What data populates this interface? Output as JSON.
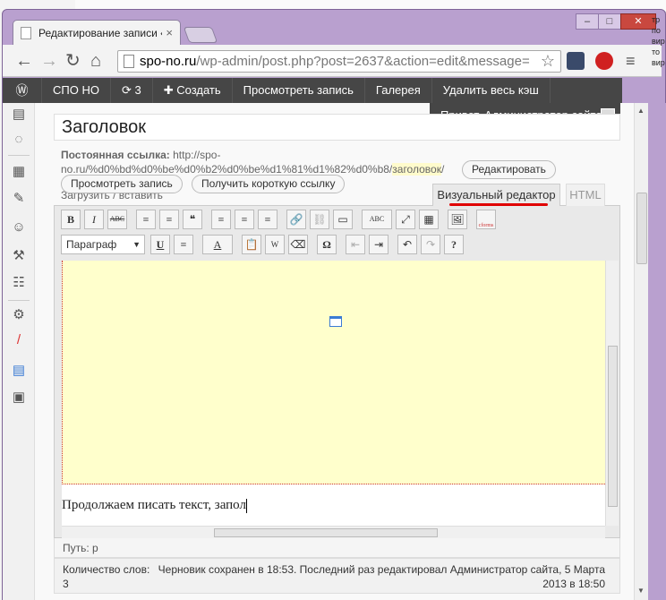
{
  "browser": {
    "tab_title": "Редактирование записи «",
    "tab_close": "×",
    "url_host": "spo-no.ru",
    "url_path": "/wp-admin/post.php?post=2637&action=edit&message=",
    "win_min": "–",
    "win_max": "□",
    "win_close": "✕"
  },
  "desktop_right_text": "тр\nпо\nвир\nто\nвир",
  "adminbar": {
    "site": "СПО НО",
    "updates": "3",
    "add": "Создать",
    "view": "Просмотреть запись",
    "gallery": "Галерея",
    "cache": "Удалить весь кэш",
    "greeting": "Привет, Администратор сайта"
  },
  "post": {
    "title": "Заголовок",
    "permalink_label": "Постоянная ссылка:",
    "permalink_url_1": "http://spo-",
    "permalink_url_2": "no.ru/%d0%bd%d0%be%d0%b2%d0%be%d1%81%d1%82%d0%b8/",
    "permalink_slug": "заголовок",
    "permalink_end": "/",
    "edit_btn": "Редактировать",
    "view_btn": "Просмотреть запись",
    "shortlink_btn": "Получить короткую ссылку",
    "upload_label": "Загрузить / вставить"
  },
  "editor": {
    "tab_visual": "Визуальный редактор",
    "tab_html": "HTML",
    "format": "Параграф",
    "row1": [
      "B",
      "I",
      "ABC",
      "≡",
      "≡",
      "❝",
      "≡",
      "≡",
      "≡",
      "🔗",
      "⛓",
      "▭",
      "ABC",
      "⤢",
      "▦",
      "🖼",
      "cforms"
    ],
    "row2": [
      "U",
      "≡",
      "A",
      "📋",
      "W",
      "⌫",
      "Ω",
      "⇤",
      "⇥",
      "↶",
      "↷",
      "?"
    ],
    "content_text": "Продолжаем писать текст, запол",
    "path": "Путь: p"
  },
  "footer": {
    "word_count": "Количество слов: 3",
    "save_status": "Черновик сохранен в 18:53. Последний раз редактировал Администратор сайта, 5 Марта 2013 в 18:50"
  }
}
